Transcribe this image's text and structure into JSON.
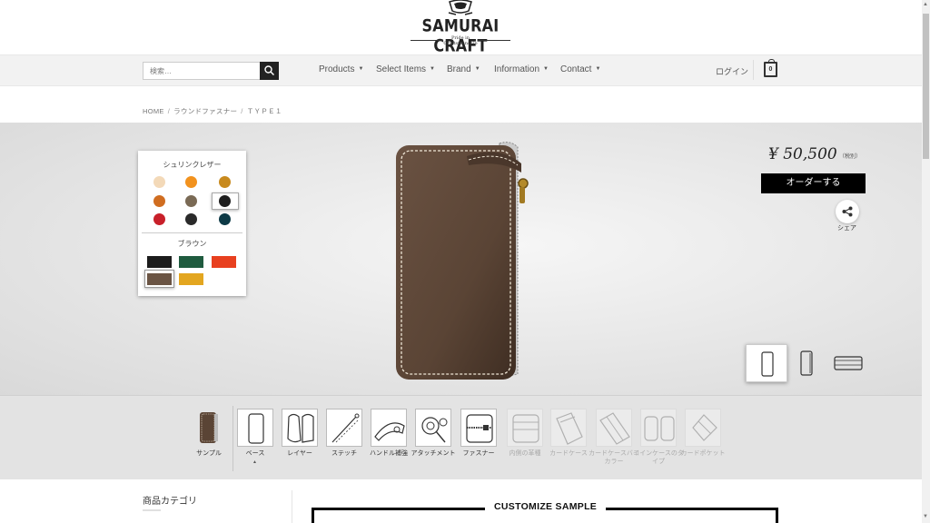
{
  "brand": {
    "name": "SAMURAI CRAFT",
    "tagline1": "Pride in",
    "tagline2": "Craftsmanship"
  },
  "search": {
    "placeholder": "検索…"
  },
  "nav": {
    "items": [
      {
        "label": "Products"
      },
      {
        "label": "Select Items"
      },
      {
        "label": "Brand"
      },
      {
        "label": "Information"
      },
      {
        "label": "Contact"
      }
    ],
    "login": "ログイン",
    "cart_count": "0"
  },
  "breadcrumb": [
    "HOME",
    "ラウンドファスナー",
    "ＴＹＰＥ１"
  ],
  "swatches": {
    "group1_title": "シュリンクレザー",
    "group1_colors": [
      "#f3d9b8",
      "#f2921e",
      "#c88a1e",
      "#d06d20",
      "#7a6a55",
      "#1e1e1e",
      "#c8202a",
      "#2a2a2a",
      "#0d3a46"
    ],
    "group2_title": "ブラウン",
    "group2_colors": [
      "#1c1c1c",
      "#1f5b3f",
      "#e8401f",
      "#6a5444",
      "#e3a620"
    ]
  },
  "product": {
    "price": "¥ 50,500",
    "tax_note": "（税別）",
    "order_label": "オーダーする",
    "share_label": "シェア",
    "leather_color": "#5a4435"
  },
  "parts": [
    {
      "label": "サンプル",
      "state": "sample"
    },
    {
      "label": "ベース",
      "state": "active"
    },
    {
      "label": "レイヤー",
      "state": "normal"
    },
    {
      "label": "ステッチ",
      "state": "normal"
    },
    {
      "label": "ハンドル補強",
      "state": "normal"
    },
    {
      "label": "アタッチメント",
      "state": "normal"
    },
    {
      "label": "ファスナー",
      "state": "normal"
    },
    {
      "label": "内側の革種",
      "state": "disabled"
    },
    {
      "label": "カードケース",
      "state": "disabled"
    },
    {
      "label": "カードケースバイカラー",
      "state": "disabled"
    },
    {
      "label": "コインケースのタイプ",
      "state": "disabled"
    },
    {
      "label": "カードポケット",
      "state": "disabled"
    }
  ],
  "sidebar": {
    "category_title": "商品カテゴリ"
  },
  "main": {
    "sample_title": "CUSTOMIZE SAMPLE"
  }
}
